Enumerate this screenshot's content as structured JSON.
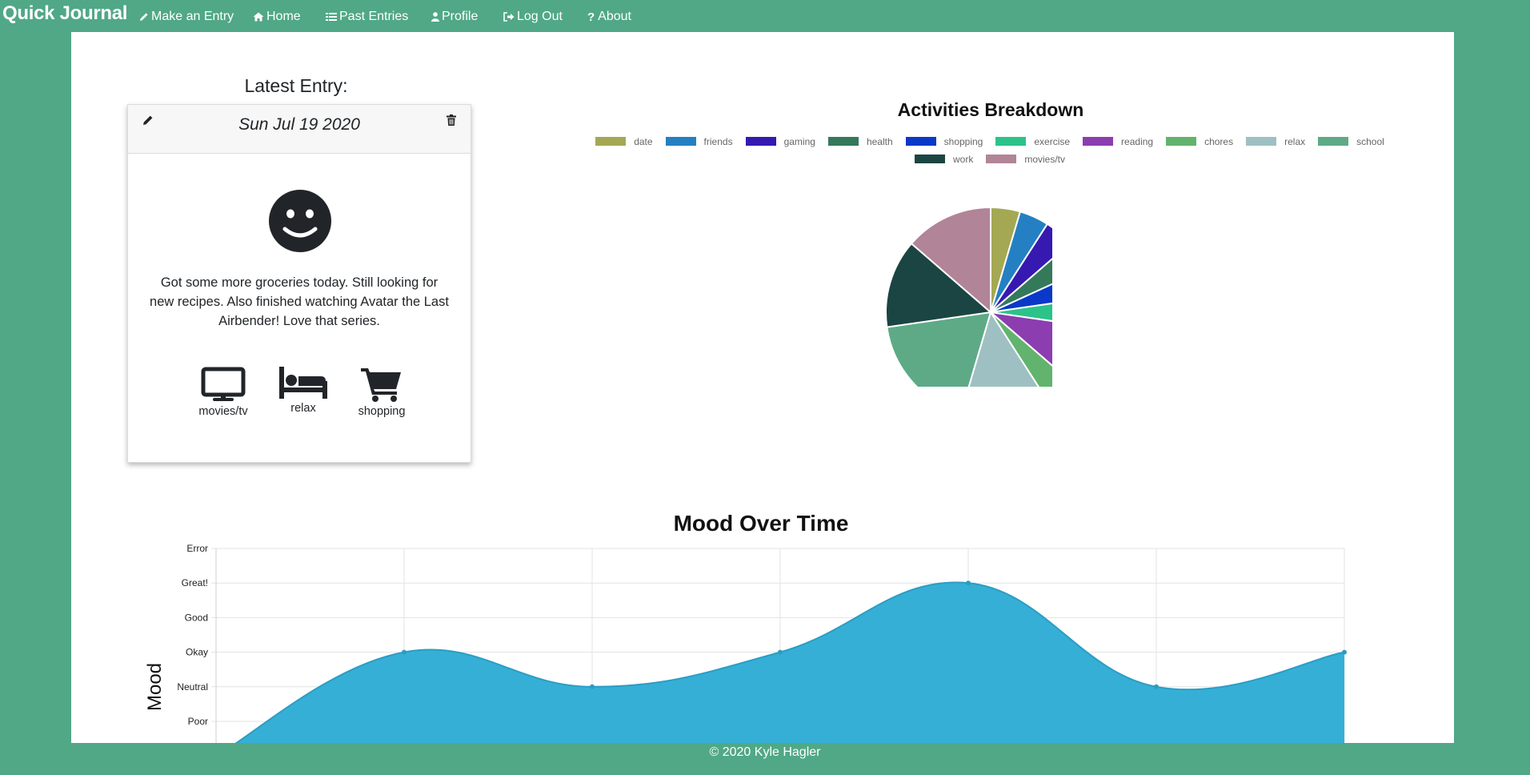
{
  "nav": {
    "brand": "Quick Journal",
    "items": [
      {
        "label": "Make an Entry",
        "icon": "pencil-icon"
      },
      {
        "label": "Home",
        "icon": "home-icon"
      },
      {
        "label": "Past Entries",
        "icon": "list-icon"
      },
      {
        "label": "Profile",
        "icon": "user-icon"
      },
      {
        "label": "Log Out",
        "icon": "logout-icon"
      },
      {
        "label": "About",
        "icon": "question-icon"
      }
    ]
  },
  "latest": {
    "heading": "Latest Entry:",
    "date": "Sun Jul 19 2020",
    "mood_icon": "smile-icon",
    "text": "Got some more groceries today. Still looking for new recipes. Also finished watching Avatar the Last Airbender! Love that series.",
    "activities": [
      {
        "label": "movies/tv",
        "icon": "tv-icon"
      },
      {
        "label": "relax",
        "icon": "bed-icon"
      },
      {
        "label": "shopping",
        "icon": "cart-icon"
      }
    ]
  },
  "chart_data": [
    {
      "type": "pie",
      "title": "Activities Breakdown",
      "legend_position": "top",
      "categories": [
        "date",
        "friends",
        "gaming",
        "health",
        "shopping",
        "exercise",
        "reading",
        "chores",
        "relax",
        "school",
        "work",
        "movies/tv"
      ],
      "values": [
        1,
        1,
        1,
        1,
        1,
        1,
        2,
        1,
        3,
        4,
        3,
        3
      ],
      "colors": [
        "#a4a853",
        "#2480c2",
        "#3619b0",
        "#33795a",
        "#0a38c8",
        "#2bc389",
        "#8c3db0",
        "#62b36e",
        "#9ec0c3",
        "#5eaa87",
        "#1b4542",
        "#b28498"
      ]
    },
    {
      "type": "area",
      "title": "Mood Over Time",
      "ylabel": "Mood",
      "xlabel": "",
      "y_tick_labels": [
        "Poor",
        "Neutral",
        "Okay",
        "Good",
        "Great!",
        "Error"
      ],
      "y_tick_values": [
        1,
        2,
        3,
        4,
        5,
        6
      ],
      "values": [
        0,
        3,
        2,
        3,
        5,
        2,
        3
      ],
      "fill_color": "#36afd6",
      "grid": true,
      "curved": true
    }
  ],
  "footer": "© 2020 Kyle Hagler"
}
